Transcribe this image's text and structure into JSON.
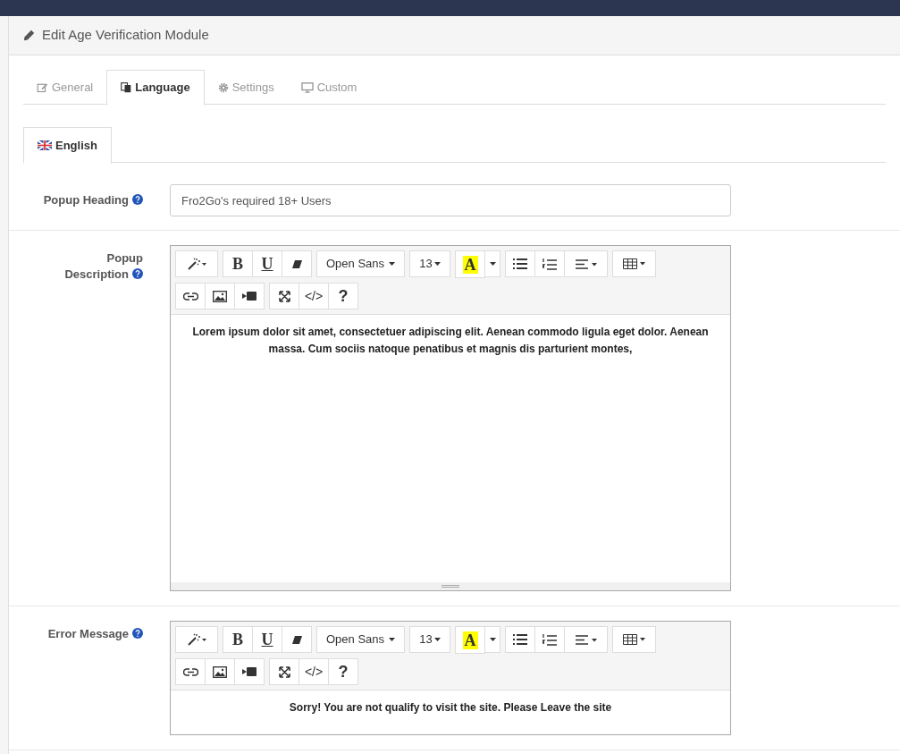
{
  "panel": {
    "title": "Edit Age Verification Module"
  },
  "tabs": [
    {
      "label": "General",
      "kind": "edit",
      "selected": false
    },
    {
      "label": "Language",
      "kind": "language",
      "selected": true
    },
    {
      "label": "Settings",
      "kind": "gear",
      "selected": false
    },
    {
      "label": "Custom",
      "kind": "monitor",
      "selected": false
    }
  ],
  "language_tabs": [
    {
      "label": "English",
      "selected": true
    }
  ],
  "fields": [
    {
      "kind": "input",
      "label": "Popup Heading",
      "value": "Fro2Go's required 18+ Users"
    },
    {
      "kind": "editor",
      "label": "Popup Description",
      "toolbar": [
        [
          [
            {
              "kind": "style"
            }
          ],
          [
            {
              "kind": "bold",
              "label": "B"
            },
            {
              "kind": "underline",
              "label": "U"
            },
            {
              "kind": "eraser"
            }
          ],
          [
            {
              "kind": "font",
              "label": "Open Sans"
            }
          ],
          [
            {
              "kind": "size",
              "label": "13"
            }
          ],
          [
            {
              "kind": "color",
              "label": "A"
            },
            {
              "kind": "caret"
            }
          ],
          [
            {
              "kind": "ul"
            },
            {
              "kind": "ol"
            },
            {
              "kind": "align"
            }
          ],
          [
            {
              "kind": "table"
            }
          ]
        ],
        [
          [
            {
              "kind": "link"
            },
            {
              "kind": "picture"
            },
            {
              "kind": "video"
            }
          ],
          [
            {
              "kind": "fullscreen"
            },
            {
              "kind": "code",
              "label": "</>"
            },
            {
              "kind": "help",
              "label": "?"
            }
          ]
        ]
      ],
      "content": "Lorem ipsum dolor sit amet, consectetuer adipiscing elit. Aenean commodo ligula eget dolor. Aenean massa. Cum sociis natoque penatibus et magnis dis parturient montes,"
    },
    {
      "kind": "editor",
      "label": "Error Message",
      "toolbar": [
        [
          [
            {
              "kind": "style"
            }
          ],
          [
            {
              "kind": "bold",
              "label": "B"
            },
            {
              "kind": "underline",
              "label": "U"
            },
            {
              "kind": "eraser"
            }
          ],
          [
            {
              "kind": "font",
              "label": "Open Sans"
            }
          ],
          [
            {
              "kind": "size",
              "label": "13"
            }
          ],
          [
            {
              "kind": "color",
              "label": "A"
            },
            {
              "kind": "caret"
            }
          ],
          [
            {
              "kind": "ul"
            },
            {
              "kind": "ol"
            },
            {
              "kind": "align"
            }
          ],
          [
            {
              "kind": "table"
            }
          ]
        ],
        [
          [
            {
              "kind": "link"
            },
            {
              "kind": "picture"
            },
            {
              "kind": "video"
            }
          ],
          [
            {
              "kind": "fullscreen"
            },
            {
              "kind": "code",
              "label": "</>"
            },
            {
              "kind": "help",
              "label": "?"
            }
          ]
        ]
      ],
      "content": "Sorry! You are not qualify to visit the site. Please Leave the site"
    }
  ]
}
